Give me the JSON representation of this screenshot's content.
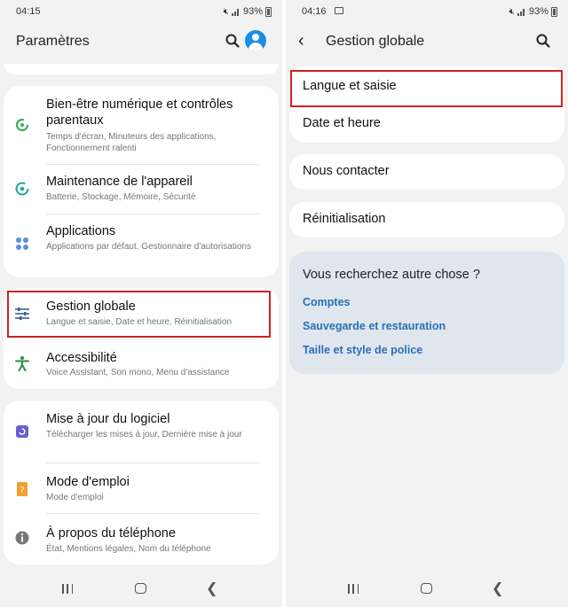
{
  "left": {
    "status": {
      "time": "04:15",
      "battery": "93%"
    },
    "title": "Paramètres",
    "groups": [
      {
        "items": [
          {
            "title": "Bien-être numérique et contrôles parentaux",
            "subtitle": "Temps d'écran, Minuteurs des applications, Fonctionnement ralenti",
            "icon": "digital-wellbeing-icon"
          },
          {
            "title": "Maintenance de l'appareil",
            "subtitle": "Batterie, Stockage, Mémoire, Sécurité",
            "icon": "device-care-icon"
          },
          {
            "title": "Applications",
            "subtitle": "Applications par défaut, Gestionnaire d'autorisations",
            "icon": "apps-icon"
          }
        ]
      },
      {
        "items": [
          {
            "title": "Gestion globale",
            "subtitle": "Langue et saisie, Date et heure, Réinitialisation",
            "icon": "sliders-icon"
          },
          {
            "title": "Accessibilité",
            "subtitle": "Voice Assistant, Son mono, Menu d'assistance",
            "icon": "accessibility-icon"
          }
        ]
      },
      {
        "items": [
          {
            "title": "Mise à jour du logiciel",
            "subtitle": "Télécharger les mises à jour, Dernière mise à jour",
            "icon": "software-update-icon"
          },
          {
            "title": "Mode d'emploi",
            "subtitle": "Mode d'emploi",
            "icon": "user-manual-icon"
          },
          {
            "title": "À propos du téléphone",
            "subtitle": "État, Mentions légales, Nom du téléphone",
            "icon": "info-icon"
          }
        ]
      }
    ]
  },
  "right": {
    "status": {
      "time": "04:16",
      "battery": "93%"
    },
    "title": "Gestion globale",
    "items": [
      "Langue et saisie",
      "Date et heure",
      "Nous contacter",
      "Réinitialisation"
    ],
    "suggestions": {
      "heading": "Vous recherchez autre chose ?",
      "links": [
        "Comptes",
        "Sauvegarde et restauration",
        "Taille et style de police"
      ]
    }
  },
  "colors": {
    "highlight": "#cc2222",
    "accent": "#1a8de9",
    "link": "#2b6fb6"
  }
}
